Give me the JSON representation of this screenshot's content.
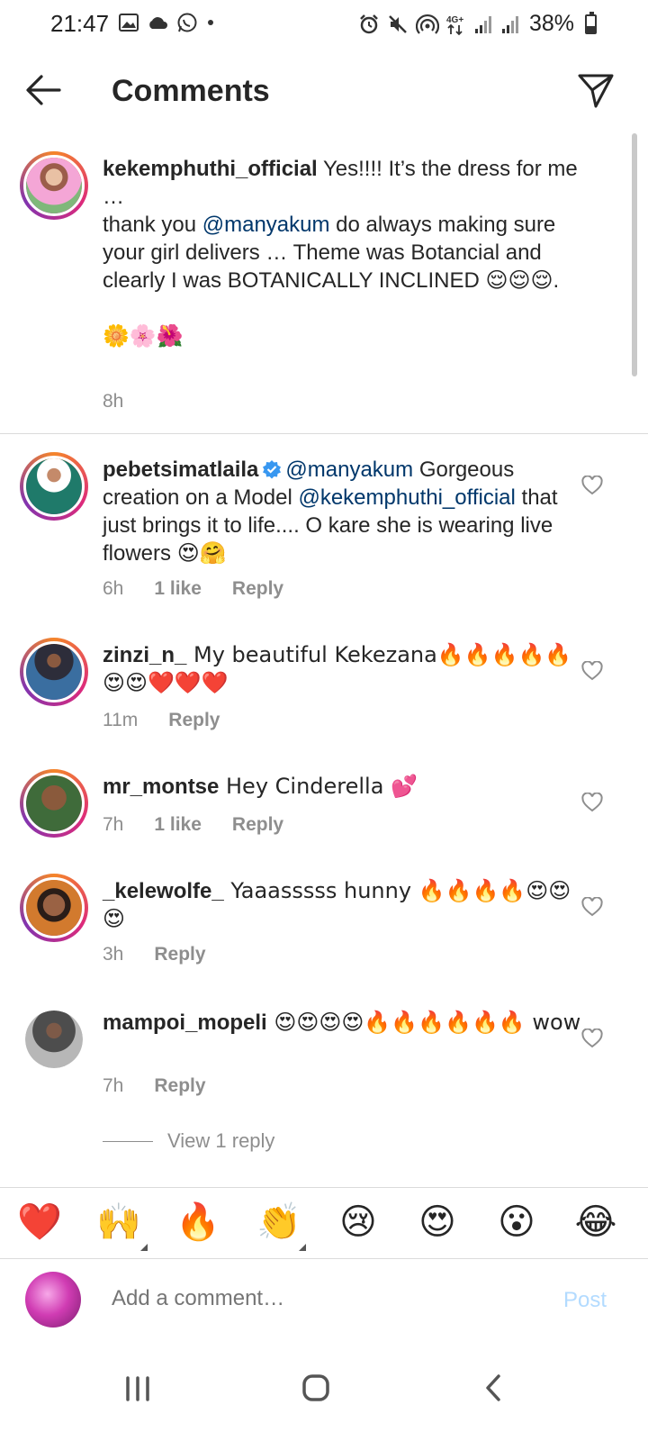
{
  "status_bar": {
    "time": "21:47",
    "battery": "38%",
    "network": "4G+"
  },
  "header": {
    "title": "Comments"
  },
  "comments": [
    {
      "username": "kekemphuthi_official",
      "text_1": " Yes!!!! It’s the dress for me …",
      "text_2": "thank you ",
      "mention_1": "@manyakum",
      "text_3": "  do always making sure your girl delivers … Theme was Botancial and clearly I was BOTANICALLY INCLINED 😌😌😌.",
      "text_4": "🌼🌸🌺",
      "time": "8h"
    },
    {
      "username": "pebetsimatlaila",
      "mention_1": "@manyakum",
      "text_1": " Gorgeous creation on a Model ",
      "mention_2": "@kekemphuthi_official",
      "text_2": " that just brings it to life.... O kare she is wearing live flowers 😍🤗",
      "time": "6h",
      "likes": "1 like",
      "reply": "Reply"
    },
    {
      "username": "zinzi_n_",
      "text": " My beautiful Kekezana🔥🔥🔥🔥🔥😍😍❤️❤️❤️",
      "time": "11m",
      "reply": "Reply"
    },
    {
      "username": "mr_montse",
      "text": " Hey Cinderella 💕",
      "time": "7h",
      "likes": "1 like",
      "reply": "Reply"
    },
    {
      "username": "_kelewolfe_",
      "text": " Yaaasssss hunny 🔥🔥🔥🔥😍😍😍",
      "time": "3h",
      "reply": "Reply"
    },
    {
      "username": "mampoi_mopeli",
      "text": " 😍😍😍😍🔥🔥🔥🔥🔥🔥 wow",
      "time": "7h",
      "reply": "Reply"
    }
  ],
  "view_replies": "View 1 reply",
  "quick_emojis": [
    "❤️",
    "🙌",
    "🔥",
    "👏",
    "😢",
    "😍",
    "😮",
    "😂"
  ],
  "composer": {
    "placeholder": "Add a comment…",
    "post_label": "Post"
  },
  "colors": {
    "mention": "#00376b",
    "muted": "#8e8e8e",
    "post_disabled": "#b3dbff",
    "verified": "#3897f0"
  }
}
